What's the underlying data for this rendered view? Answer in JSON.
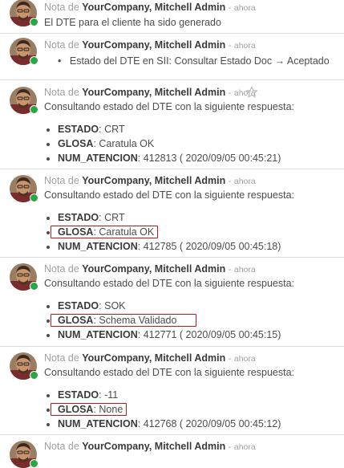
{
  "header": {
    "prefix": "Nota de",
    "author": "YourCompany, Mitchell Admin",
    "separator": "-",
    "date": "ahora"
  },
  "messages": [
    {
      "body": "El DTE para el cliente ha sido generado"
    },
    {
      "tracking": {
        "field": "Estado del DTE en SII:",
        "old_value": "Consultar Estado Doc",
        "arrow": "→",
        "new_value": "Aceptado"
      }
    },
    {
      "body": "Consultando estado del DTE con la siguiente respuesta:",
      "starred": false,
      "fields": [
        {
          "label": "ESTADO",
          "value": ": CRT"
        },
        {
          "label": "GLOSA",
          "value": ": Caratula OK"
        },
        {
          "label": "NUM_ATENCION",
          "value": ": 412813 ( 2020/09/05 00:45:21)"
        }
      ]
    },
    {
      "body": "Consultando estado del DTE con la siguiente respuesta:",
      "fields": [
        {
          "label": "ESTADO",
          "value": ": CRT"
        },
        {
          "label": "GLOSA",
          "value": ": Caratula OK"
        },
        {
          "label": "NUM_ATENCION",
          "value": ": 412785 ( 2020/09/05 00:45:18)"
        }
      ]
    },
    {
      "body": "Consultando estado del DTE con la siguiente respuesta:",
      "fields": [
        {
          "label": "ESTADO",
          "value": ": SOK"
        },
        {
          "label": "GLOSA",
          "value": ": Schema Validado"
        },
        {
          "label": "NUM_ATENCION",
          "value": ": 412771 ( 2020/09/05 00:45:15)"
        }
      ]
    },
    {
      "body": "Consultando estado del DTE con la siguiente respuesta:",
      "fields": [
        {
          "label": "ESTADO",
          "value": ": -11"
        },
        {
          "label": "GLOSA",
          "value": ": None"
        },
        {
          "label": "NUM_ATENCION",
          "value": ": 412768 ( 2020/09/05 00:45:12)"
        }
      ]
    },
    {}
  ],
  "colors": {
    "highlight_border": "#c01818",
    "presence_online": "#28a745",
    "muted_text": "#a0a0a0"
  }
}
